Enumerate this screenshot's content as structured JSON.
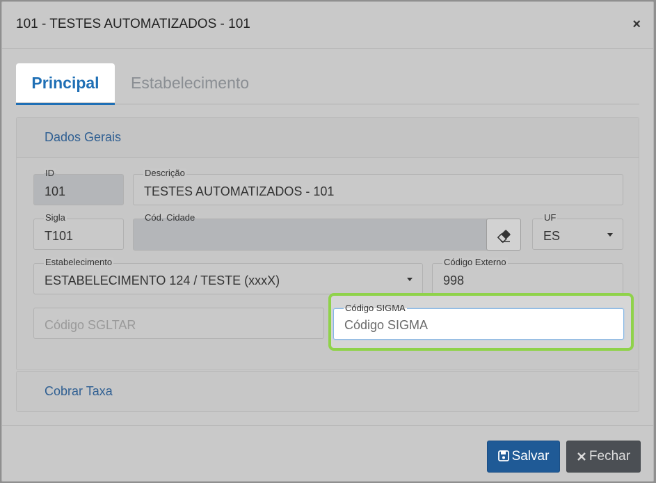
{
  "modal": {
    "title": "101 - TESTES AUTOMATIZADOS - 101",
    "close_symbol": "×"
  },
  "tabs": [
    {
      "label": "Principal",
      "active": true
    },
    {
      "label": "Estabelecimento",
      "active": false
    }
  ],
  "dados_gerais": {
    "title": "Dados Gerais",
    "fields": {
      "id": {
        "label": "ID",
        "value": "101"
      },
      "descricao": {
        "label": "Descrição",
        "value": "TESTES AUTOMATIZADOS - 101"
      },
      "sigla": {
        "label": "Sigla",
        "value": "T101"
      },
      "cod_cidade": {
        "label": "Cód. Cidade",
        "value": ""
      },
      "uf": {
        "label": "UF",
        "value": "ES"
      },
      "estabelecimento": {
        "label": "Estabelecimento",
        "value": "ESTABELECIMENTO 124 / TESTE (xxxX)"
      },
      "codigo_externo": {
        "label": "Código Externo",
        "value": "998"
      },
      "codigo_sgltar": {
        "label": "",
        "placeholder": "Código SGLTAR"
      },
      "codigo_sigma": {
        "label": "Código SIGMA",
        "placeholder": "Código SIGMA"
      }
    }
  },
  "cobrar_taxa": {
    "title": "Cobrar Taxa"
  },
  "footer": {
    "save_label": "Salvar",
    "close_label": "Fechar"
  },
  "colors": {
    "primary": "#1f6fb5",
    "save_button": "#1f5a96",
    "close_button": "#4b4f54",
    "highlight": "#8fd24a"
  },
  "icons": [
    "close-icon",
    "eraser-icon",
    "chevron-down-icon",
    "save-icon",
    "x-icon"
  ]
}
